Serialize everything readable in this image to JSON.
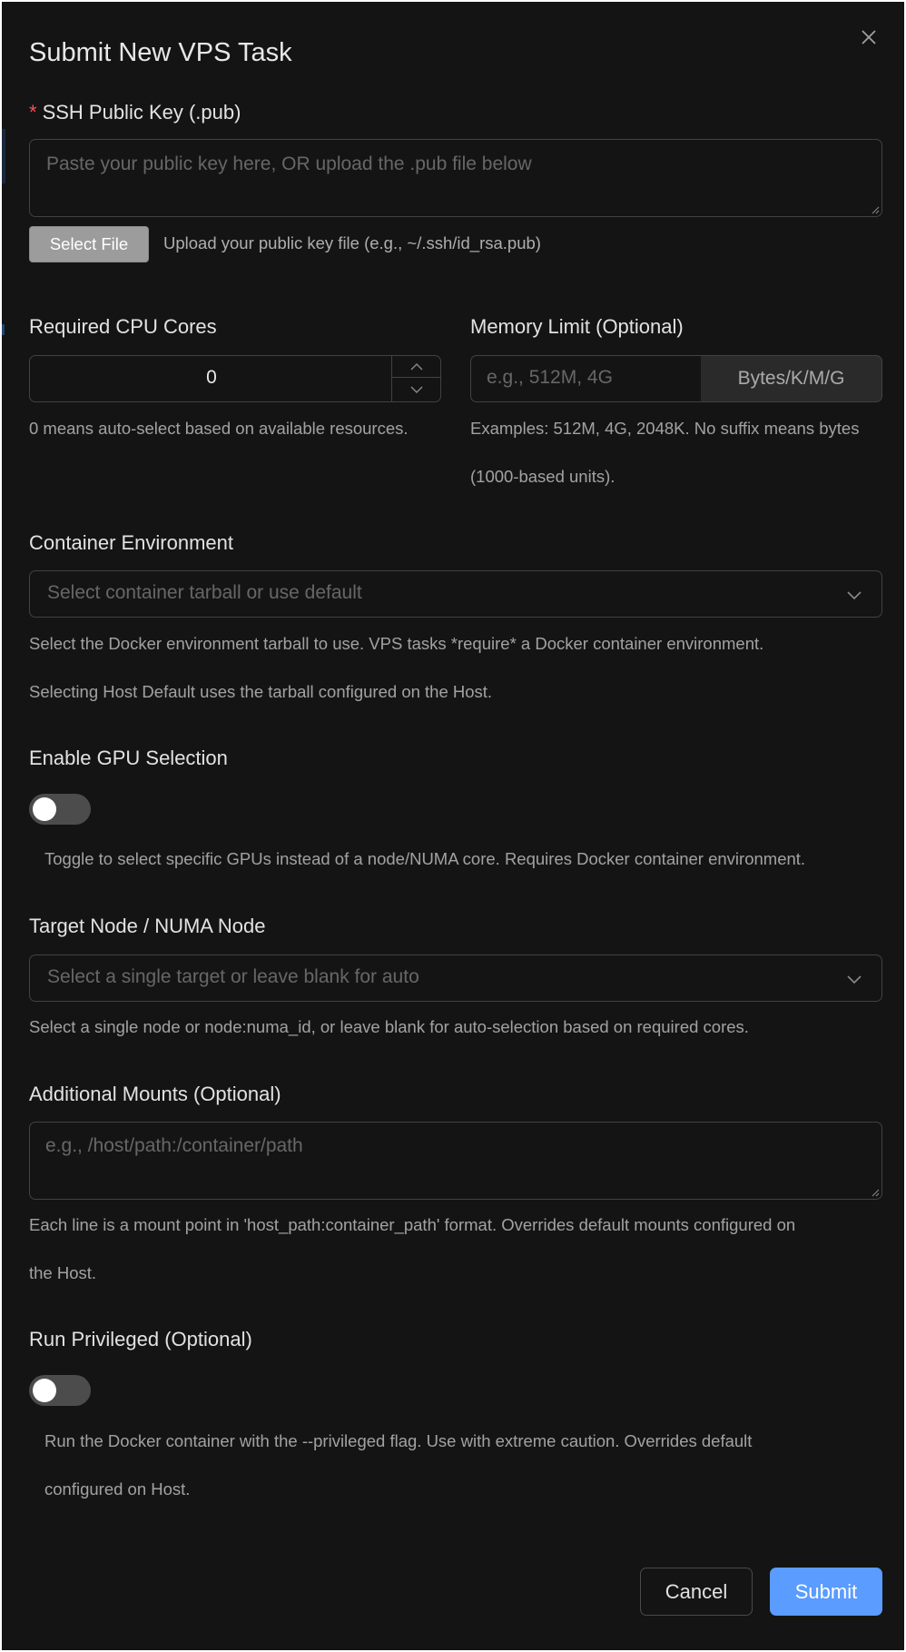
{
  "modal": {
    "title": "Submit New VPS Task"
  },
  "ssh": {
    "required_mark": "*",
    "label": "SSH Public Key (.pub)",
    "placeholder": "Paste your public key here, OR upload the .pub file below",
    "file_button": "Select File",
    "file_help": "Upload your public key file (e.g., ~/.ssh/id_rsa.pub)"
  },
  "cpu": {
    "label": "Required CPU Cores",
    "value": "0",
    "help": "0 means auto-select based on available resources."
  },
  "memory": {
    "label": "Memory Limit (Optional)",
    "placeholder": "e.g., 512M, 4G",
    "addon": "Bytes/K/M/G",
    "help_line1": "Examples: 512M, 4G, 2048K. No suffix means bytes",
    "help_line2": "(1000-based units)."
  },
  "container": {
    "label": "Container Environment",
    "placeholder": "Select container tarball or use default",
    "help_line1": "Select the Docker environment tarball to use. VPS tasks *require* a Docker container environment.",
    "help_line2": "Selecting Host Default uses the tarball configured on the Host."
  },
  "gpu": {
    "label": "Enable GPU Selection",
    "help": "Toggle to select specific GPUs instead of a node/NUMA core. Requires Docker container environment."
  },
  "target": {
    "label": "Target Node / NUMA Node",
    "placeholder": "Select a single target or leave blank for auto",
    "help": "Select a single node or node:numa_id, or leave blank for auto-selection based on required cores."
  },
  "mounts": {
    "label": "Additional Mounts (Optional)",
    "placeholder": "e.g., /host/path:/container/path",
    "help_line1": "Each line is a mount point in 'host_path:container_path' format. Overrides default mounts configured on",
    "help_line2": "the Host."
  },
  "privileged": {
    "label": "Run Privileged (Optional)",
    "help_line1": "Run the Docker container with the --privileged flag. Use with extreme caution. Overrides default",
    "help_line2": "configured on Host."
  },
  "footer": {
    "cancel": "Cancel",
    "submit": "Submit"
  },
  "colors": {
    "background": "#141414",
    "primary": "#5a9cff",
    "required": "#ff4d4f",
    "border": "#424242"
  }
}
